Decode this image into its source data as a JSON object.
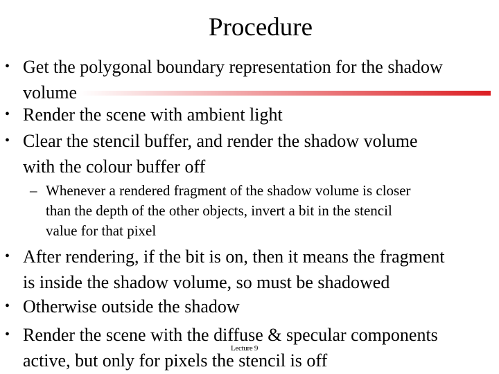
{
  "slide": {
    "title": "Procedure",
    "accent_color": "#dc1e23",
    "bullets": [
      {
        "mark": "•",
        "text": "Get the polygonal boundary representation for the shadow\nvolume"
      },
      {
        "mark": "•",
        "text": "Render the scene with ambient light"
      },
      {
        "mark": "•",
        "text": "Clear the stencil buffer, and render the shadow volume\nwith the colour buffer off"
      }
    ],
    "sub_bullets": [
      {
        "mark": "–",
        "text": "Whenever a rendered fragment of the shadow volume is closer\nthan the depth of the other objects, invert a bit in the stencil\nvalue for that pixel"
      }
    ],
    "bullets_after": [
      {
        "mark": "•",
        "text": "After rendering, if the bit is on, then it means the fragment\nis inside the shadow volume, so must be shadowed"
      },
      {
        "mark": "•",
        "text": "Otherwise outside the shadow"
      },
      {
        "mark": "•",
        "text": "Render the scene with the diffuse & specular components\nactive, but only for pixels the stencil is off"
      }
    ],
    "footer": "Lecture 9"
  }
}
